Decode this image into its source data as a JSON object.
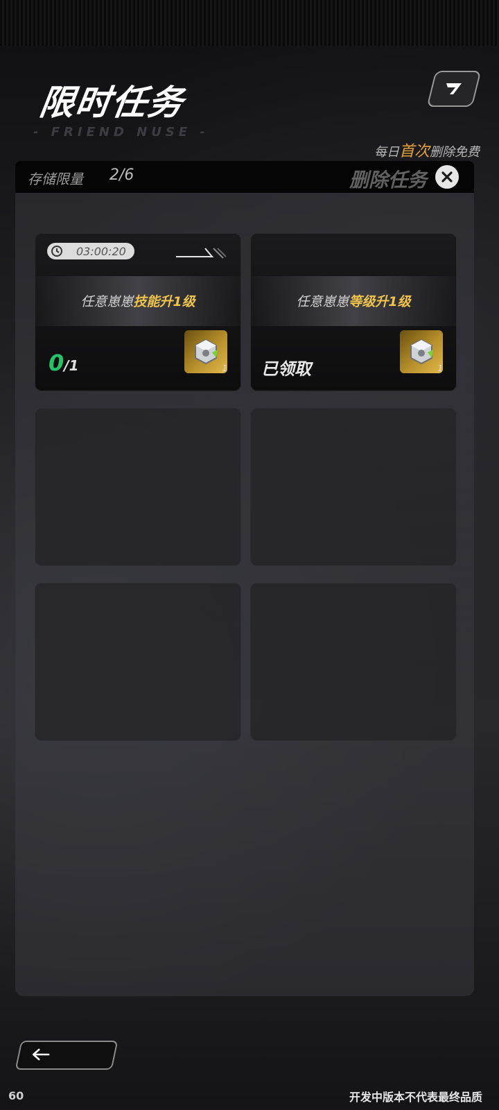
{
  "header": {
    "title": "限时任务",
    "subtitle": "- FRIEND NUSE -",
    "daily_note_prefix": "每日",
    "daily_note_highlight": "首次",
    "daily_note_suffix": "删除免费"
  },
  "storage": {
    "label": "存储限量",
    "value": "2/6",
    "delete_label": "删除任务"
  },
  "tasks": [
    {
      "timer": "03:00:20",
      "text_prefix": "任意崽崽",
      "text_highlight": "技能升1级",
      "progress_current": "0",
      "progress_total": "1",
      "reward_icon": "gear-cube-icon",
      "reward_count": "1"
    },
    {
      "text_prefix": "任意崽崽",
      "text_highlight": "等级升1级",
      "status": "已领取",
      "reward_icon": "gear-cube-icon",
      "reward_count": "1"
    }
  ],
  "fps": "60",
  "footer_note": "开发中版本不代表最终品质",
  "colors": {
    "highlight": "#f0c34a",
    "progress": "#26c26a",
    "accent_orange": "#e3a03a"
  }
}
